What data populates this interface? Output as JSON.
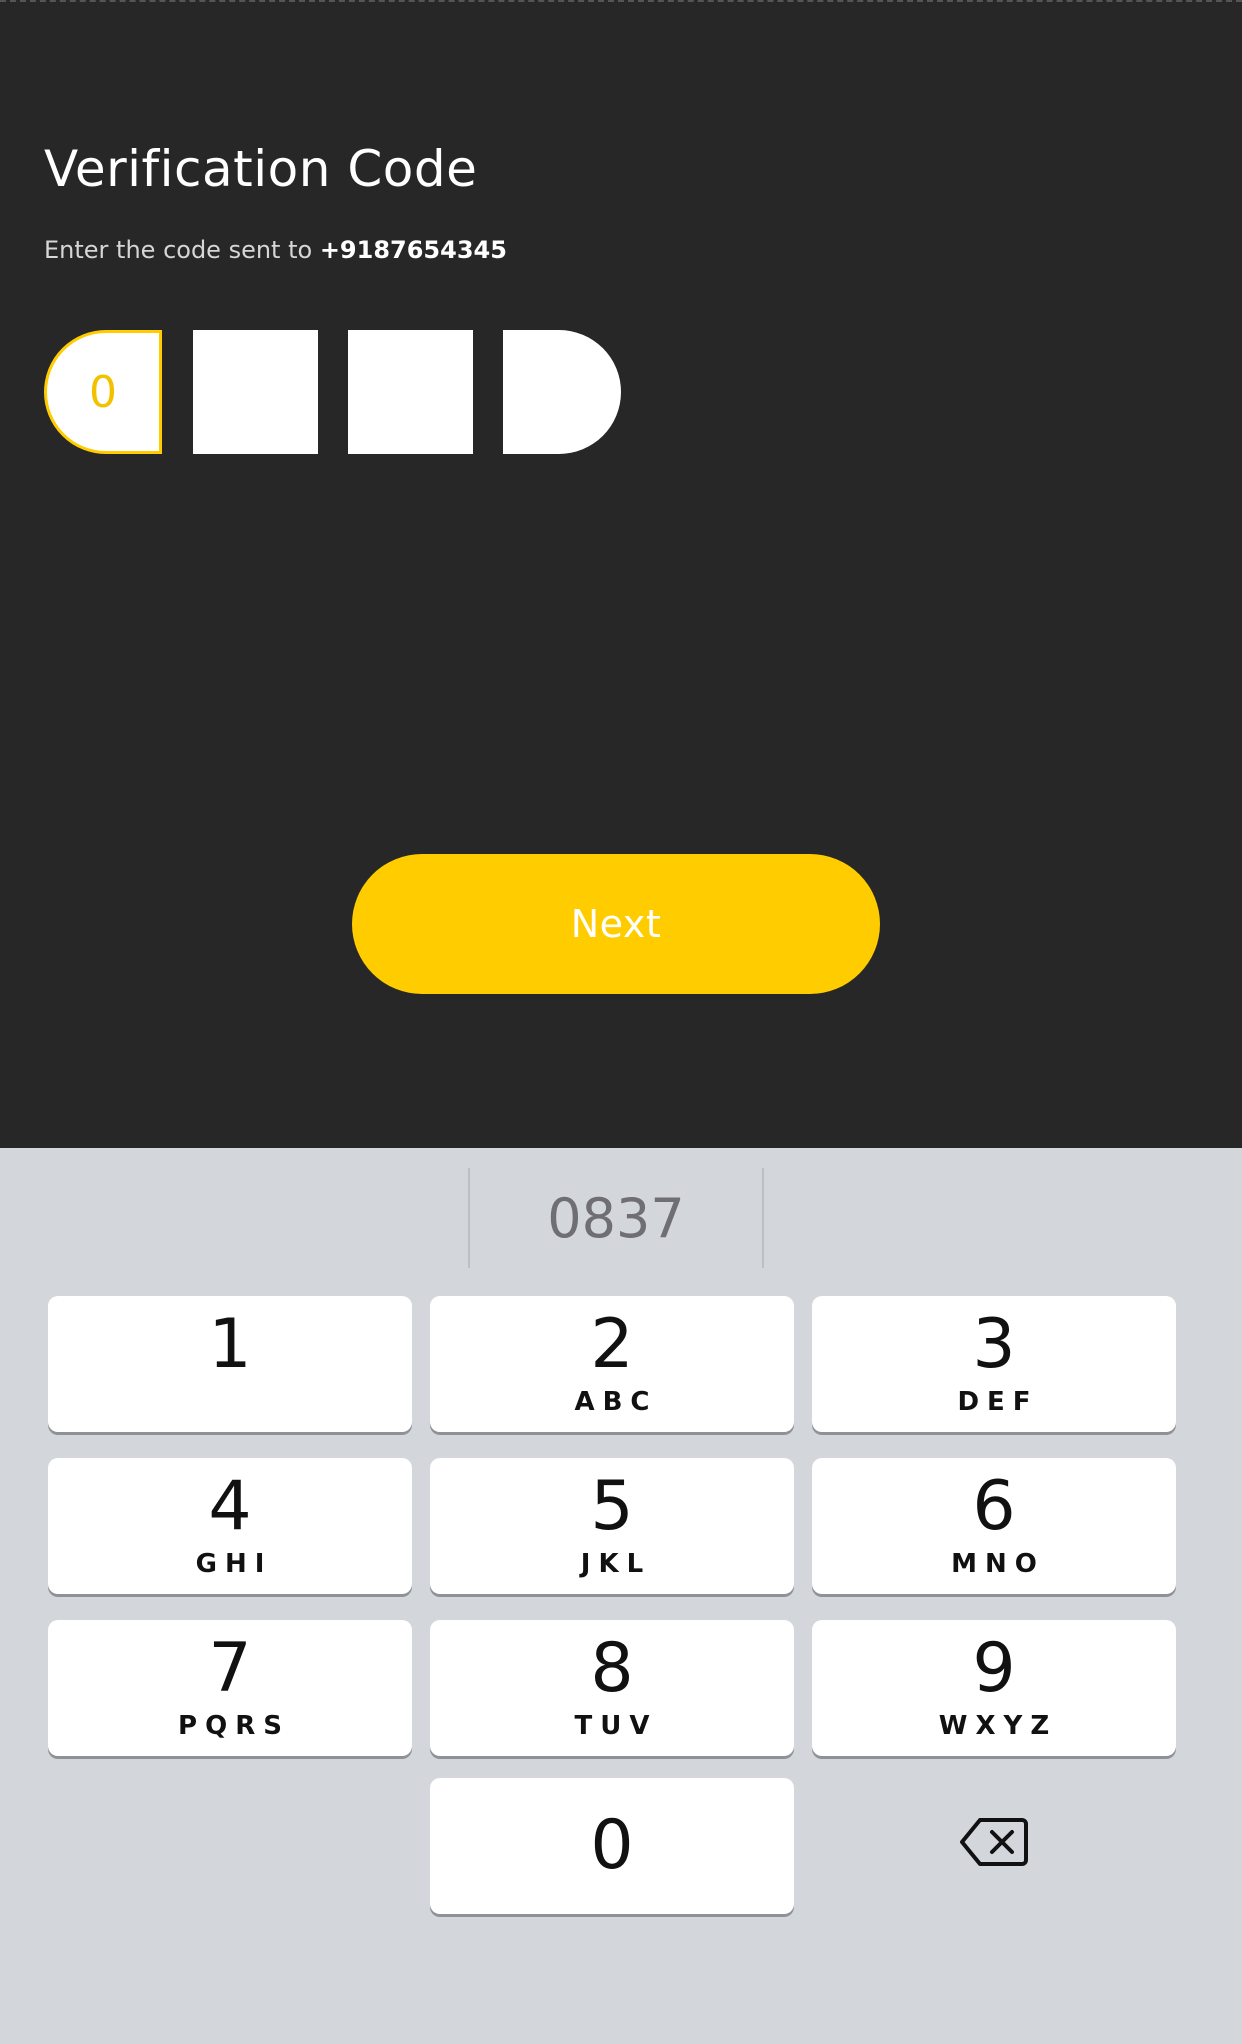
{
  "header": {
    "title": "Verification Code",
    "subtitle_prefix": "Enter the code sent to ",
    "phone": "+9187654345"
  },
  "otp": {
    "digits": [
      "0",
      "",
      "",
      ""
    ],
    "active_color": "#ffcc00"
  },
  "actions": {
    "next_label": "Next",
    "accent": "#ffcc00"
  },
  "keyboard": {
    "suggestion": "0837",
    "keys": [
      {
        "num": "1",
        "letters": ""
      },
      {
        "num": "2",
        "letters": "ABC"
      },
      {
        "num": "3",
        "letters": "DEF"
      },
      {
        "num": "4",
        "letters": "GHI"
      },
      {
        "num": "5",
        "letters": "JKL"
      },
      {
        "num": "6",
        "letters": "MNO"
      },
      {
        "num": "7",
        "letters": "PQRS"
      },
      {
        "num": "8",
        "letters": "TUV"
      },
      {
        "num": "9",
        "letters": "WXYZ"
      },
      {
        "num": "0",
        "letters": ""
      }
    ],
    "backspace_icon": "backspace-icon"
  }
}
